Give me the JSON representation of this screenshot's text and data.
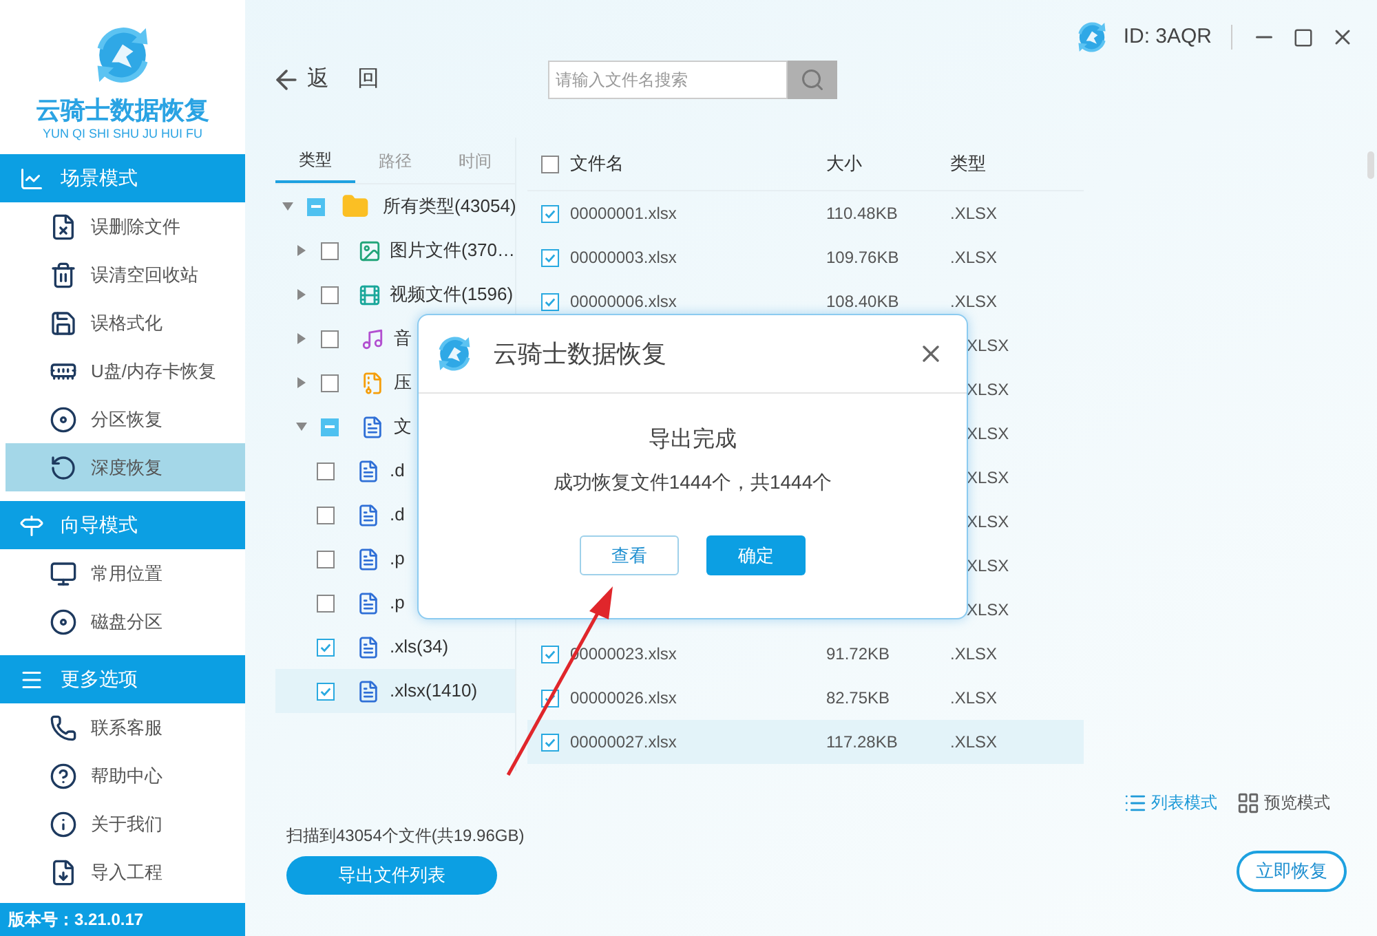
{
  "brand": {
    "title": "云骑士数据恢复",
    "subtitle": "YUN QI SHI SHU JU HUI FU"
  },
  "sidebar": {
    "sections": [
      {
        "title": "场景模式",
        "kind": "scene",
        "items": [
          {
            "label": "误删除文件",
            "kind": "delete",
            "selected": false
          },
          {
            "label": "误清空回收站",
            "kind": "recycle",
            "selected": false
          },
          {
            "label": "误格式化",
            "kind": "format",
            "selected": false
          },
          {
            "label": "U盘/内存卡恢复",
            "kind": "card",
            "selected": false
          },
          {
            "label": "分区恢复",
            "kind": "partition",
            "selected": false
          },
          {
            "label": "深度恢复",
            "kind": "deep",
            "selected": true
          }
        ]
      },
      {
        "title": "向导模式",
        "kind": "guide",
        "items": [
          {
            "label": "常用位置",
            "kind": "location",
            "selected": false
          },
          {
            "label": "磁盘分区",
            "kind": "partition",
            "selected": false
          }
        ]
      },
      {
        "title": "更多选项",
        "kind": "more",
        "items": [
          {
            "label": "联系客服",
            "kind": "phone",
            "selected": false
          },
          {
            "label": "帮助中心",
            "kind": "help",
            "selected": false
          },
          {
            "label": "关于我们",
            "kind": "about",
            "selected": false
          },
          {
            "label": "导入工程",
            "kind": "import",
            "selected": false
          }
        ]
      }
    ],
    "version": "版本号：3.21.0.17"
  },
  "title_bar": {
    "user_id": "ID: 3AQR"
  },
  "toolbar": {
    "back": "返 回",
    "search": {
      "placeholder": "请输入文件名搜索"
    }
  },
  "tree": {
    "tabs": [
      {
        "label": "类型",
        "selected": true
      },
      {
        "label": "路径",
        "selected": false
      },
      {
        "label": "时间",
        "selected": false
      }
    ],
    "items": [
      {
        "label": "所有类型(43054)",
        "kind": "folder",
        "indeterminate": true,
        "expanded": true,
        "selected": false,
        "children": [
          {
            "label": "图片文件(370…",
            "kind": "image",
            "checked": false,
            "indeterminate": false,
            "expanded": false,
            "selected": false
          },
          {
            "label": "视频文件(1596)",
            "kind": "video",
            "checked": false,
            "indeterminate": false,
            "expanded": false,
            "selected": false
          },
          {
            "label": "音",
            "kind": "audio",
            "checked": false,
            "indeterminate": false,
            "expanded": false,
            "selected": false
          },
          {
            "label": "压",
            "kind": "archive",
            "checked": false,
            "indeterminate": false,
            "expanded": false,
            "selected": false
          },
          {
            "label": "文",
            "kind": "document",
            "indeterminate": true,
            "expanded": true,
            "selected": false,
            "children": [
              {
                "label": ".d",
                "kind": "document",
                "checked": false,
                "indeterminate": false,
                "selected": false
              },
              {
                "label": ".d",
                "kind": "document",
                "checked": false,
                "indeterminate": false,
                "selected": false
              },
              {
                "label": ".p",
                "kind": "document",
                "checked": false,
                "indeterminate": false,
                "selected": false
              },
              {
                "label": ".p",
                "kind": "document",
                "checked": false,
                "indeterminate": false,
                "selected": false
              },
              {
                "label": ".xls(34)",
                "kind": "document",
                "checked": true,
                "indeterminate": false,
                "selected": false
              },
              {
                "label": ".xlsx(1410)",
                "kind": "document",
                "checked": true,
                "indeterminate": false,
                "selected": true
              }
            ]
          }
        ]
      }
    ]
  },
  "files": {
    "header_checked": false,
    "columns": [
      "文件名",
      "大小",
      "类型"
    ],
    "rows": [
      {
        "kind": "full",
        "name": "00000001.xlsx",
        "size": "110.48KB",
        "type": ".XLSX",
        "checked": true,
        "selected": false
      },
      {
        "kind": "full",
        "name": "00000003.xlsx",
        "size": "109.76KB",
        "type": ".XLSX",
        "checked": true,
        "selected": false
      },
      {
        "kind": "full",
        "name": "00000006.xlsx",
        "size": "108.40KB",
        "type": ".XLSX",
        "checked": true,
        "selected": false
      },
      {
        "kind": "covered",
        "type": "XLSX"
      },
      {
        "kind": "covered",
        "type": "XLSX"
      },
      {
        "kind": "covered",
        "type": "XLSX"
      },
      {
        "kind": "covered",
        "type": "XLSX"
      },
      {
        "kind": "covered",
        "type": "XLSX"
      },
      {
        "kind": "covered",
        "type": "XLSX"
      },
      {
        "kind": "covered",
        "type": "XLSX"
      },
      {
        "kind": "full",
        "name": "00000023.xlsx",
        "size": "91.72KB",
        "type": ".XLSX",
        "checked": true,
        "selected": false
      },
      {
        "kind": "full",
        "name": "00000026.xlsx",
        "size": "82.75KB",
        "type": ".XLSX",
        "checked": true,
        "selected": false
      },
      {
        "kind": "full",
        "name": "00000027.xlsx",
        "size": "117.28KB",
        "type": ".XLSX",
        "checked": true,
        "selected": true
      }
    ]
  },
  "footer": {
    "scan_summary": "扫描到43054个文件(共19.96GB)",
    "export_button": "导出文件列表",
    "view_modes": [
      {
        "label": "列表模式",
        "kind": "list",
        "selected": true
      },
      {
        "label": "预览模式",
        "kind": "grid",
        "selected": false
      }
    ],
    "recover_button": "立即恢复"
  },
  "dialog": {
    "title": "云骑士数据恢复",
    "heading": "导出完成",
    "message": "成功恢复文件1444个，共1444个",
    "buttons": [
      {
        "label": "查看",
        "kind": "secondary"
      },
      {
        "label": "确定",
        "kind": "primary"
      }
    ]
  }
}
